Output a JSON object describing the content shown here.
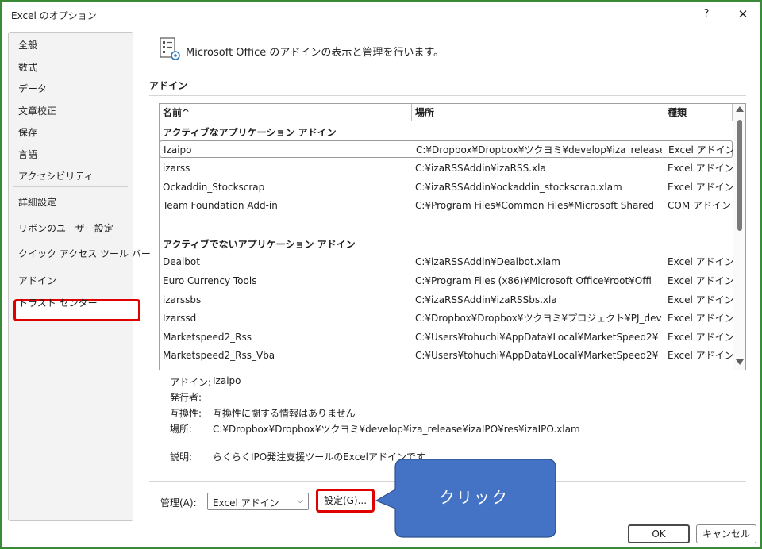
{
  "window": {
    "title": "Excel のオプション",
    "help_glyph": "?",
    "close_glyph": "✕"
  },
  "sidebar": {
    "items": [
      {
        "label": "全般"
      },
      {
        "label": "数式"
      },
      {
        "label": "データ"
      },
      {
        "label": "文章校正"
      },
      {
        "label": "保存"
      },
      {
        "label": "言語"
      },
      {
        "label": "アクセシビリティ"
      },
      {
        "label": "詳細設定"
      },
      {
        "label": "リボンのユーザー設定"
      },
      {
        "label": "クイック アクセス ツール バー"
      },
      {
        "label": "アドイン"
      },
      {
        "label": "トラスト センター"
      }
    ],
    "selected": "アドイン",
    "highlight_color": "#e00000"
  },
  "header": {
    "description": "Microsoft Office のアドインの表示と管理を行います。"
  },
  "addins_section": {
    "title": "アドイン",
    "columns": {
      "name": "名前^",
      "location": "場所",
      "type": "種類"
    },
    "groups": [
      {
        "heading": "アクティブなアプリケーション アドイン",
        "rows": [
          {
            "name": "Izaipo",
            "location": "C:¥Dropbox¥Dropbox¥ツクヨミ¥develop¥iza_release¥",
            "type": "Excel アドイン",
            "selected": true
          },
          {
            "name": "izarss",
            "location": "C:¥izaRSSAddin¥izaRSS.xla",
            "type": "Excel アドイン"
          },
          {
            "name": "Ockaddin_Stockscrap",
            "location": "C:¥izaRSSAddin¥ockaddin_stockscrap.xlam",
            "type": "Excel アドイン"
          },
          {
            "name": "Team Foundation Add-in",
            "location": "C:¥Program Files¥Common Files¥Microsoft Shared",
            "type": "COM アドイン"
          }
        ]
      },
      {
        "heading": "アクティブでないアプリケーション アドイン",
        "rows": [
          {
            "name": "Dealbot",
            "location": "C:¥izaRSSAddin¥Dealbot.xlam",
            "type": "Excel アドイン"
          },
          {
            "name": "Euro Currency Tools",
            "location": "C:¥Program Files (x86)¥Microsoft Office¥root¥Offi",
            "type": "Excel アドイン"
          },
          {
            "name": "izarssbs",
            "location": "C:¥izaRSSAddin¥izaRSSbs.xla",
            "type": "Excel アドイン"
          },
          {
            "name": "Izarssd",
            "location": "C:¥Dropbox¥Dropbox¥ツクヨミ¥プロジェクト¥PJ_dev",
            "type": "Excel アドイン"
          },
          {
            "name": "Marketspeed2_Rss",
            "location": "C:¥Users¥tohuchi¥AppData¥Local¥MarketSpeed2¥",
            "type": "Excel アドイン"
          },
          {
            "name": "Marketspeed2_Rss_Vba",
            "location": "C:¥Users¥tohuchi¥AppData¥Local¥MarketSpeed2¥",
            "type": "Excel アドイン"
          }
        ]
      }
    ]
  },
  "details": {
    "addin_label": "アドイン:",
    "addin_value": "Izaipo",
    "publisher_label": "発行者:",
    "publisher_value": "",
    "compat_label": "互換性:",
    "compat_value": "互換性に関する情報はありません",
    "location_label": "場所:",
    "location_value": "C:¥Dropbox¥Dropbox¥ツクヨミ¥develop¥iza_release¥izaIPO¥res¥izaIPO.xlam",
    "description_label": "説明:",
    "description_value": "らくらくIPO発注支援ツールのExcelアドインです"
  },
  "manage": {
    "label": "管理(A):",
    "select_value": "Excel アドイン",
    "go_button": "設定(G)..."
  },
  "callout": {
    "text": "クリック",
    "color": "#4472c4"
  },
  "buttons": {
    "ok": "OK",
    "cancel": "キャンセル"
  }
}
